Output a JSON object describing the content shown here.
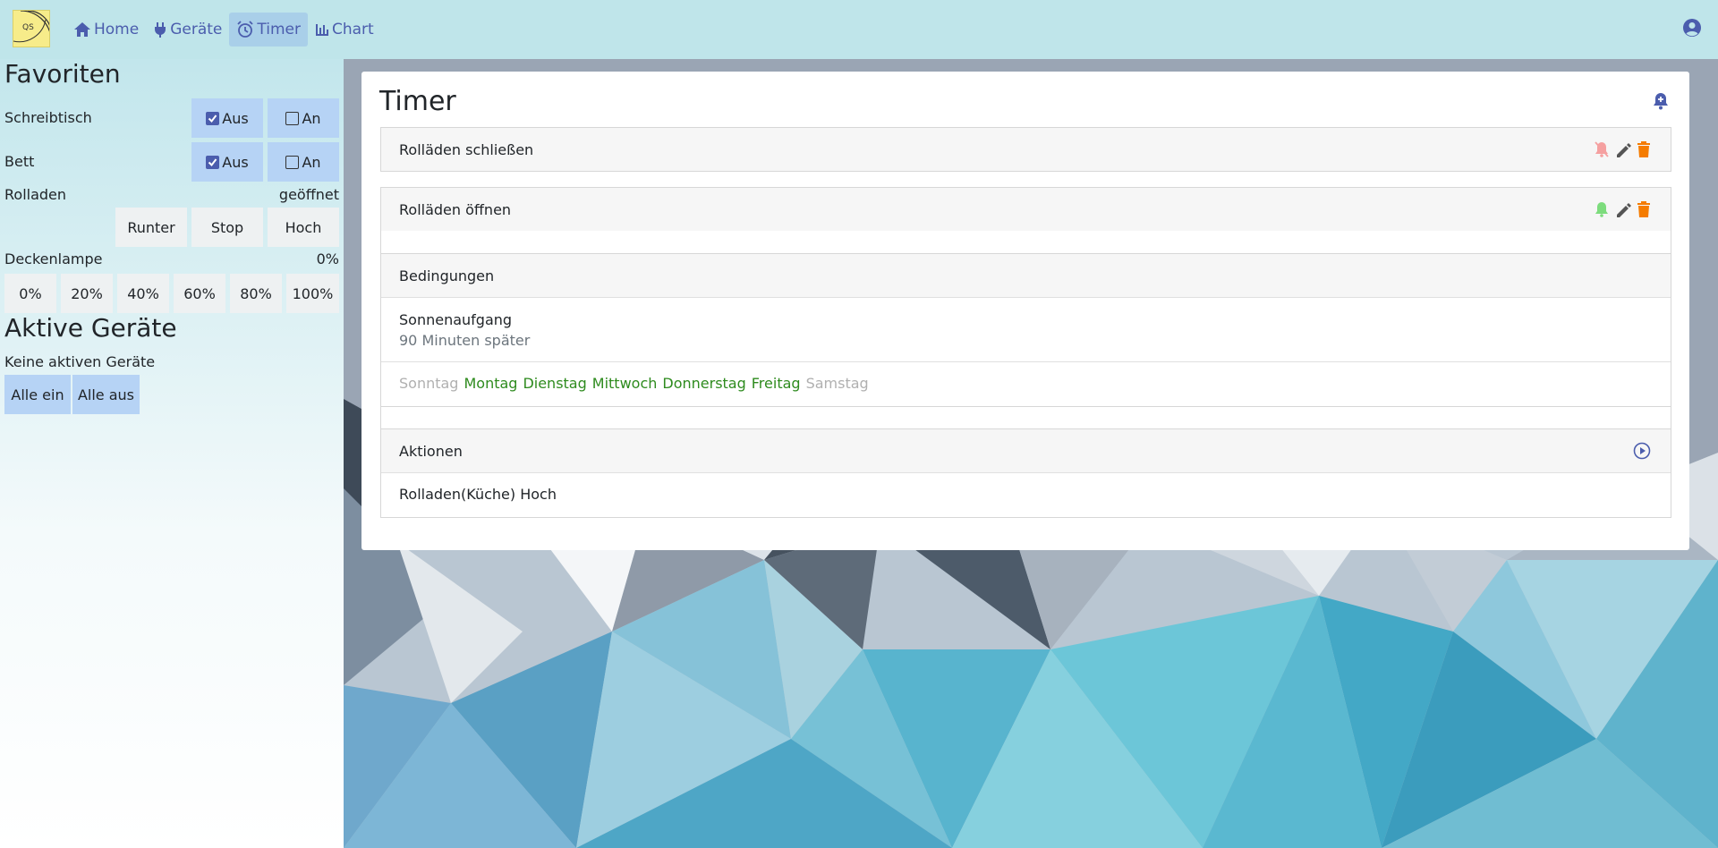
{
  "nav": {
    "logo_text": "QS",
    "items": [
      {
        "label": "Home",
        "icon": "home-icon"
      },
      {
        "label": "Geräte",
        "icon": "plug-icon"
      },
      {
        "label": "Timer",
        "icon": "alarm-clock-icon",
        "active": true
      },
      {
        "label": "Chart",
        "icon": "bar-chart-icon"
      }
    ],
    "user_icon": "user-circle-icon"
  },
  "sidebar": {
    "favorites_title": "Favoriten",
    "devices": [
      {
        "name": "Schreibtisch",
        "off_label": "Aus",
        "on_label": "An",
        "off_checked": true
      },
      {
        "name": "Bett",
        "off_label": "Aus",
        "on_label": "An",
        "off_checked": true
      }
    ],
    "rolladen": {
      "name": "Rolladen",
      "status": "geöffnet",
      "buttons": [
        "Runter",
        "Stop",
        "Hoch"
      ]
    },
    "lamp": {
      "name": "Deckenlampe",
      "value": "0%",
      "levels": [
        "0%",
        "20%",
        "40%",
        "60%",
        "80%",
        "100%"
      ]
    },
    "active_title": "Aktive Geräte",
    "no_active": "Keine aktiven Geräte",
    "all_on": "Alle ein",
    "all_off": "Alle aus"
  },
  "card": {
    "title": "Timer",
    "timers": [
      {
        "name": "Rolläden schließen",
        "enabled": false
      },
      {
        "name": "Rolläden öffnen",
        "enabled": true,
        "conditions_title": "Bedingungen",
        "condition_name": "Sonnenaufgang",
        "condition_detail": "90 Minuten später",
        "days": [
          {
            "label": "Sonntag",
            "active": false
          },
          {
            "label": "Montag",
            "active": true
          },
          {
            "label": "Dienstag",
            "active": true
          },
          {
            "label": "Mittwoch",
            "active": true
          },
          {
            "label": "Donnerstag",
            "active": true
          },
          {
            "label": "Freitag",
            "active": true
          },
          {
            "label": "Samstag",
            "active": false
          }
        ],
        "actions_title": "Aktionen",
        "action": "Rolladen(Küche) Hoch"
      }
    ]
  },
  "colors": {
    "accent": "#4b5dad",
    "delete": "#f57c00",
    "bell_on": "#7ddc7d",
    "bell_off": "#f5a0a0",
    "day_active": "#2e8b1e"
  }
}
